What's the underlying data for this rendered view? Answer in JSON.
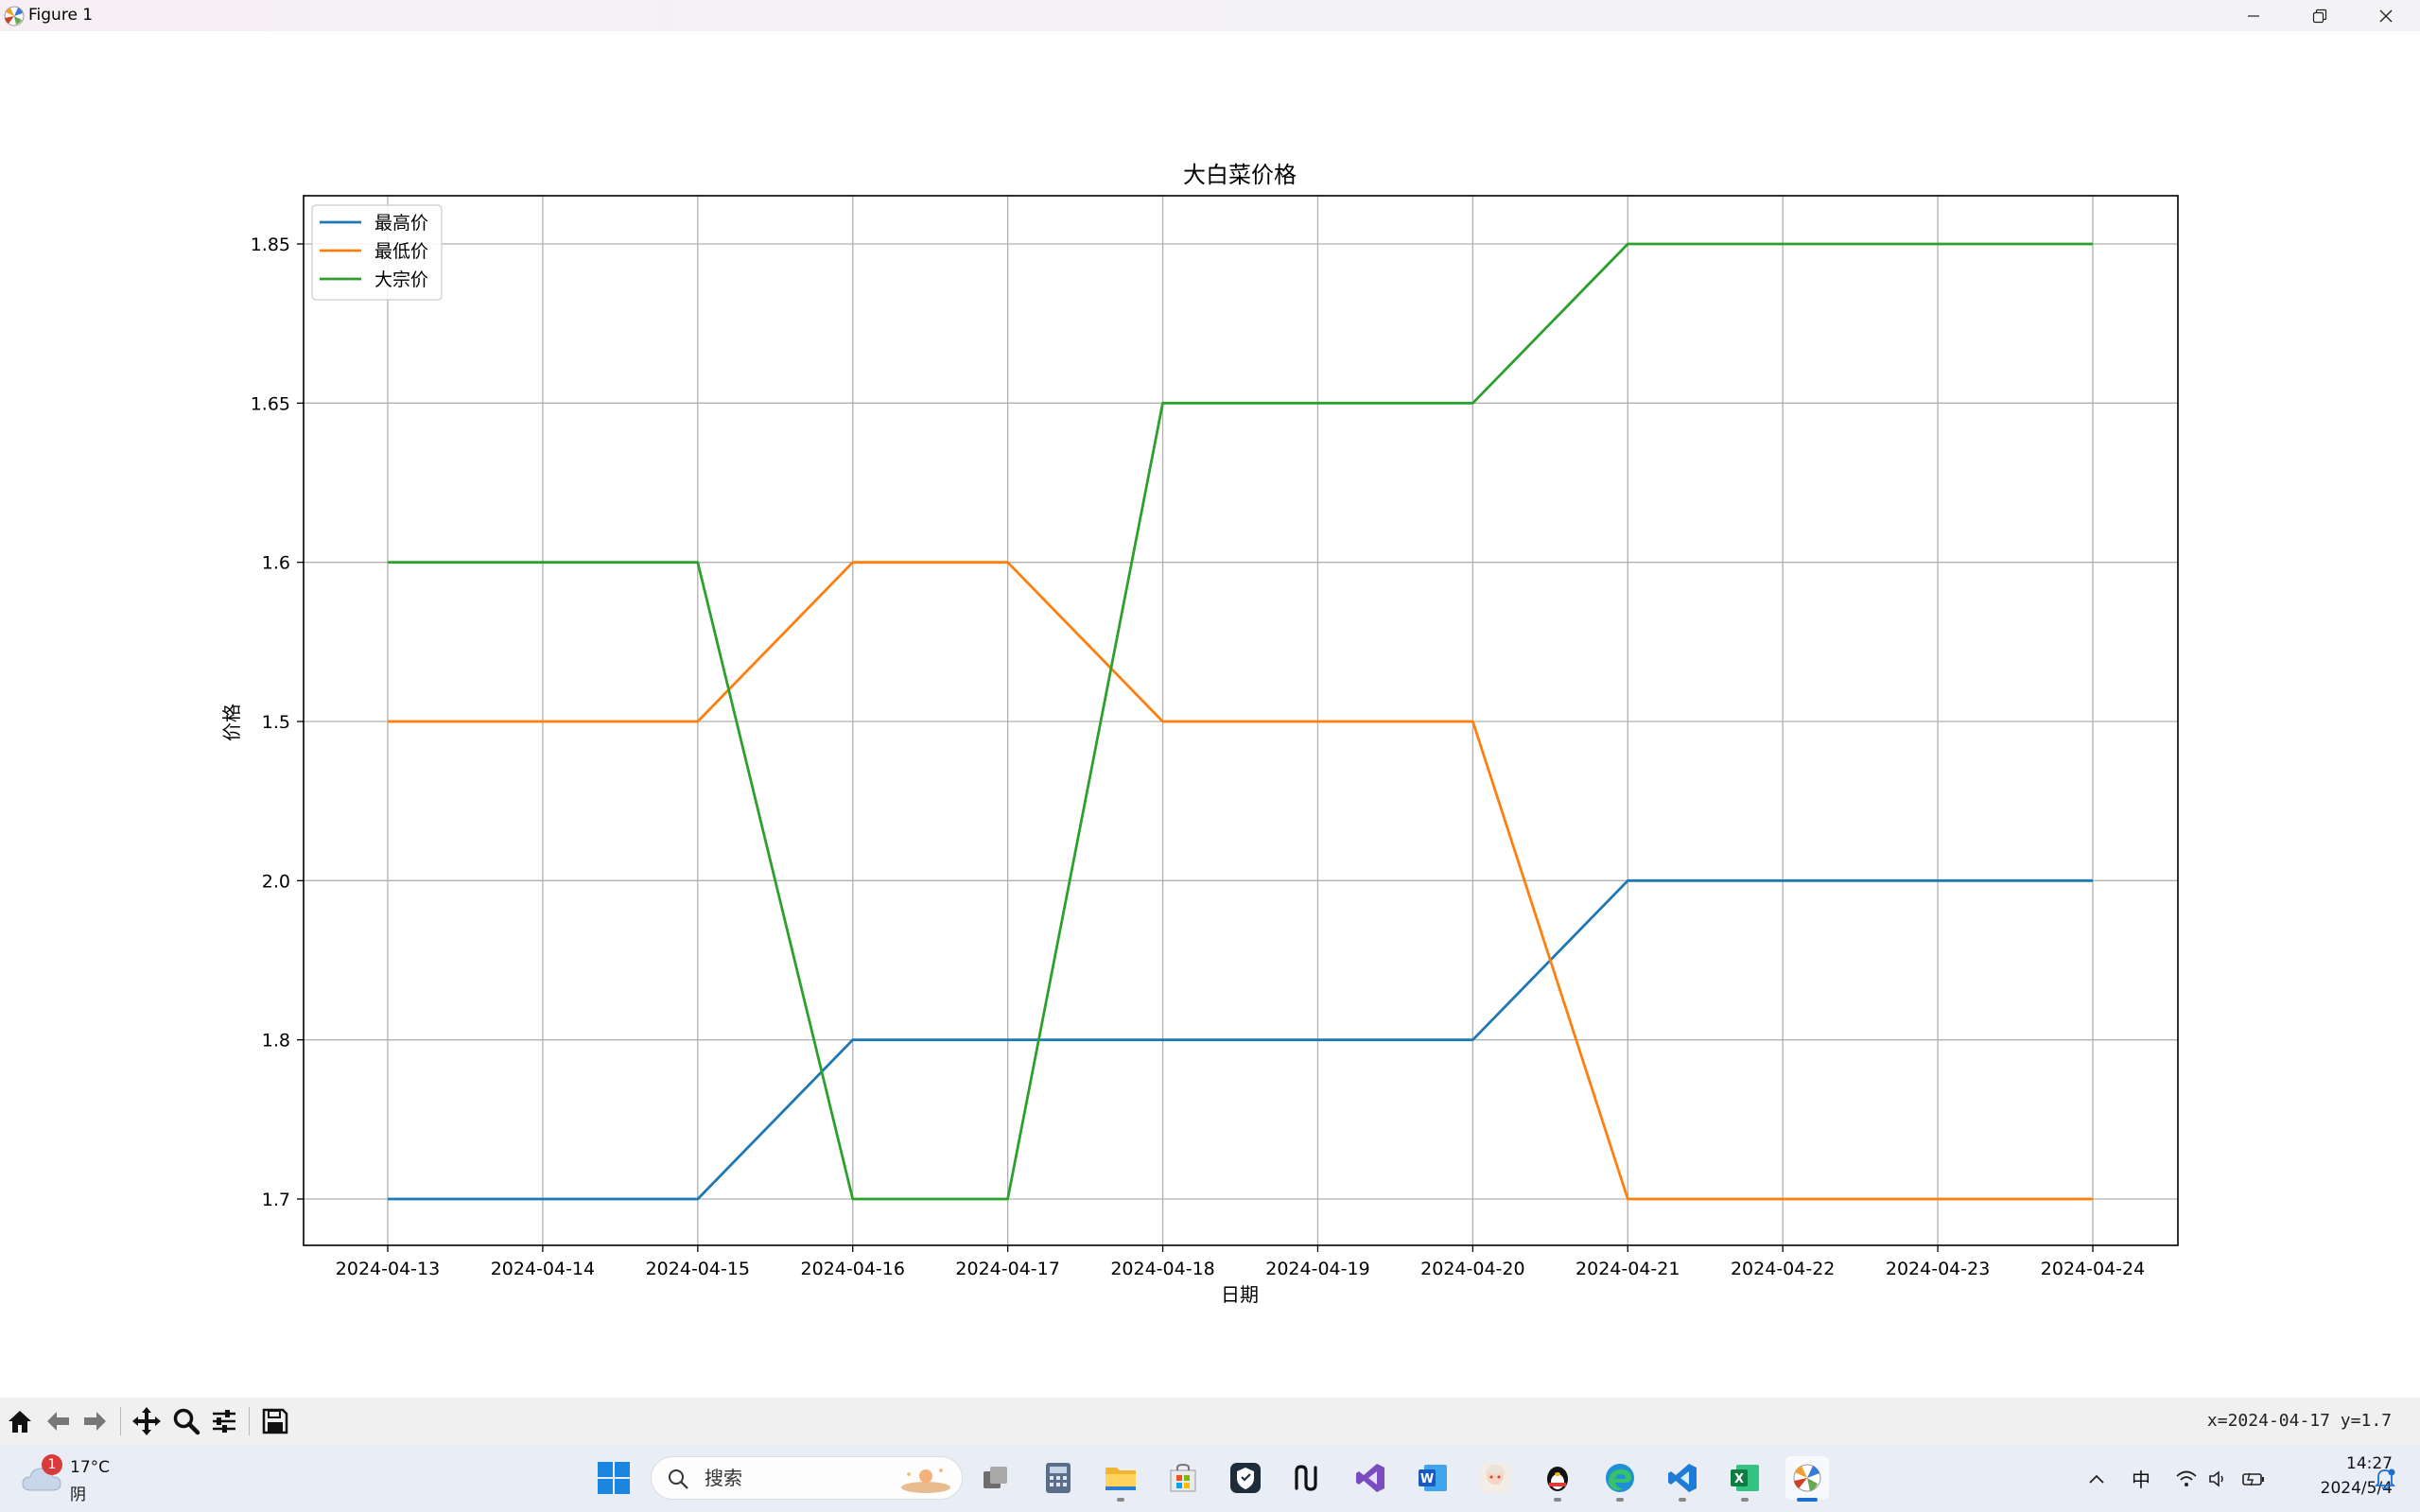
{
  "window": {
    "title": "Figure 1"
  },
  "chart_data": {
    "type": "line",
    "title": "大白菜价格",
    "xlabel": "日期",
    "ylabel": "价格",
    "categories": [
      "2024-04-13",
      "2024-04-14",
      "2024-04-15",
      "2024-04-16",
      "2024-04-17",
      "2024-04-18",
      "2024-04-19",
      "2024-04-20",
      "2024-04-21",
      "2024-04-22",
      "2024-04-23",
      "2024-04-24"
    ],
    "y_categories": [
      "1.7",
      "1.8",
      "2.0",
      "1.5",
      "1.6",
      "1.65",
      "1.85"
    ],
    "series": [
      {
        "name": "最高价",
        "color": "#1f77b4",
        "values": [
          "1.7",
          "1.7",
          "1.7",
          "1.8",
          "1.8",
          "1.8",
          "1.8",
          "1.8",
          "2.0",
          "2.0",
          "2.0",
          "2.0"
        ]
      },
      {
        "name": "最低价",
        "color": "#ff7f0e",
        "values": [
          "1.5",
          "1.5",
          "1.5",
          "1.6",
          "1.6",
          "1.5",
          "1.5",
          "1.5",
          "1.7",
          "1.7",
          "1.7",
          "1.7"
        ]
      },
      {
        "name": "大宗价",
        "color": "#2ca02c",
        "values": [
          "1.6",
          "1.6",
          "1.6",
          "1.7",
          "1.7",
          "1.65",
          "1.65",
          "1.65",
          "1.85",
          "1.85",
          "1.85",
          "1.85"
        ]
      }
    ],
    "grid": true,
    "legend": "top-left",
    "y_axis_note": "categorical axis, values plotted in order of first appearance"
  },
  "toolbar": {
    "coordinates": "x=2024-04-17 y=1.7"
  },
  "taskbar": {
    "weather_badge": "1",
    "weather_temp": "17°C",
    "weather_condition": "阴",
    "search_placeholder": "搜索",
    "ime_label": "中",
    "clock_time": "14:27",
    "clock_date": "2024/5/4"
  }
}
